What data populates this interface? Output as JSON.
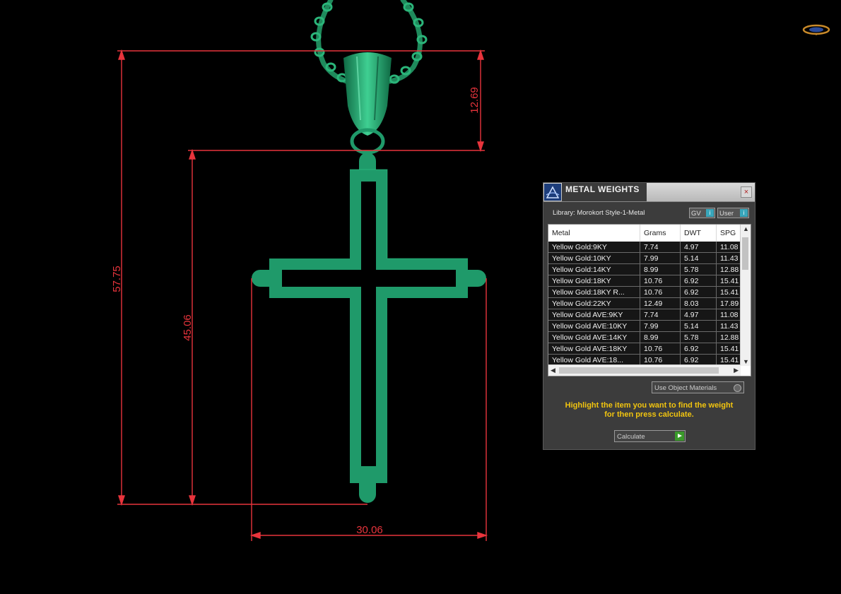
{
  "dimensions": {
    "total_height": "57.75",
    "bail_height": "12.69",
    "cross_height": "45.06",
    "cross_width": "30.06"
  },
  "panel": {
    "title": "METAL WEIGHTS",
    "close_label": "×",
    "library": "Library: Morokort Style-1-Metal",
    "gv_label": "GV",
    "user_label": "User",
    "columns": [
      "Metal",
      "Grams",
      "DWT",
      "SPG"
    ],
    "rows": [
      [
        "Yellow Gold:9KY",
        "7.74",
        "4.97",
        "11.08"
      ],
      [
        "Yellow Gold:10KY",
        "7.99",
        "5.14",
        "11.43"
      ],
      [
        "Yellow Gold:14KY",
        "8.99",
        "5.78",
        "12.88"
      ],
      [
        "Yellow Gold:18KY",
        "10.76",
        "6.92",
        "15.41"
      ],
      [
        "Yellow Gold:18KY R...",
        "10.76",
        "6.92",
        "15.41"
      ],
      [
        "Yellow Gold:22KY",
        "12.49",
        "8.03",
        "17.89"
      ],
      [
        "Yellow Gold AVE:9KY",
        "7.74",
        "4.97",
        "11.08"
      ],
      [
        "Yellow Gold AVE:10KY",
        "7.99",
        "5.14",
        "11.43"
      ],
      [
        "Yellow Gold AVE:14KY",
        "8.99",
        "5.78",
        "12.88"
      ],
      [
        "Yellow Gold AVE:18KY",
        "10.76",
        "6.92",
        "15.41"
      ],
      [
        "Yellow Gold AVE:18...",
        "10.76",
        "6.92",
        "15.41"
      ]
    ],
    "use_object_materials": "Use Object Materials",
    "instructions_line1": "Highlight the item you want to find the weight",
    "instructions_line2": "for then press calculate.",
    "calculate_label": "Calculate"
  },
  "colors": {
    "dimension": "#e8343c",
    "model": "#1f9a6a",
    "instructions": "#f1c40f"
  }
}
